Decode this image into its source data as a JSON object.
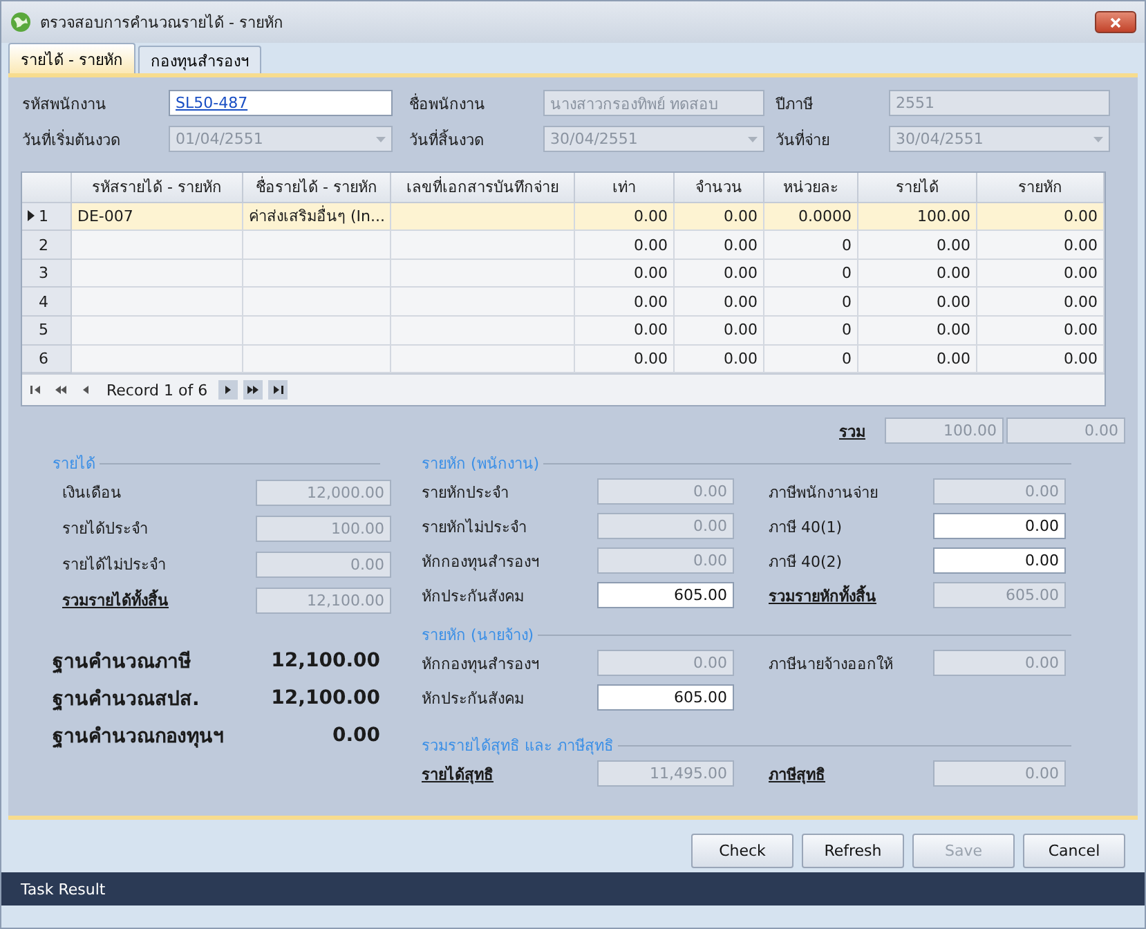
{
  "window": {
    "title": "ตรวจสอบการคำนวณรายได้ - รายหัก"
  },
  "tabs": [
    {
      "label": "รายได้ - รายหัก",
      "selected": true
    },
    {
      "label": "กองทุนสำรองฯ",
      "selected": false
    }
  ],
  "header_fields": [
    {
      "label": "รหัสพนักงาน",
      "value": "SL50-487",
      "kind": "link",
      "disabled": false
    },
    {
      "label": "ชื่อพนักงาน",
      "value": "นางสาวกรองทิพย์ ทดสอบ",
      "kind": "text",
      "disabled": true
    },
    {
      "label": "ปีภาษี",
      "value": "2551",
      "kind": "text",
      "disabled": true
    },
    {
      "label": "วันที่เริ่มต้นงวด",
      "value": "01/04/2551",
      "kind": "date",
      "disabled": true
    },
    {
      "label": "วันที่สิ้นงวด",
      "value": "30/04/2551",
      "kind": "date",
      "disabled": true
    },
    {
      "label": "วันที่จ่าย",
      "value": "30/04/2551",
      "kind": "date",
      "disabled": true
    }
  ],
  "grid": {
    "columns": [
      "รหัสรายได้ - รายหัก",
      "ชื่อรายได้ - รายหัก",
      "เลขที่เอกสารบันทึกจ่าย",
      "เท่า",
      "จำนวน",
      "หน่วยละ",
      "รายได้",
      "รายหัก"
    ],
    "rows": [
      {
        "number": "1",
        "selected": true,
        "cells": [
          "DE-007",
          "ค่าส่งเสริมอื่นๆ (In...",
          null,
          "0.00",
          "0.00",
          "0.0000",
          "100.00",
          "0.00"
        ]
      },
      {
        "number": "2",
        "selected": false,
        "cells": [
          null,
          null,
          null,
          "0.00",
          "0.00",
          "0",
          "0.00",
          "0.00"
        ]
      },
      {
        "number": "3",
        "selected": false,
        "cells": [
          null,
          null,
          null,
          "0.00",
          "0.00",
          "0",
          "0.00",
          "0.00"
        ]
      },
      {
        "number": "4",
        "selected": false,
        "cells": [
          null,
          null,
          null,
          "0.00",
          "0.00",
          "0",
          "0.00",
          "0.00"
        ]
      },
      {
        "number": "5",
        "selected": false,
        "cells": [
          null,
          null,
          null,
          "0.00",
          "0.00",
          "0",
          "0.00",
          "0.00"
        ]
      },
      {
        "number": "6",
        "selected": false,
        "cells": [
          null,
          null,
          null,
          "0.00",
          "0.00",
          "0",
          "0.00",
          "0.00"
        ]
      }
    ],
    "navigator": {
      "record_text": "Record 1 of 6"
    }
  },
  "totals": {
    "label": "รวม",
    "values": [
      "100.00",
      "0.00"
    ]
  },
  "income": {
    "title": "รายได้",
    "rows": [
      {
        "label": "เงินเดือน",
        "value": "12,000.00",
        "disabled": true,
        "emphasis": false
      },
      {
        "label": "รายได้ประจำ",
        "value": "100.00",
        "disabled": true,
        "emphasis": false
      },
      {
        "label": "รายได้ไม่ประจำ",
        "value": "0.00",
        "disabled": true,
        "emphasis": false
      },
      {
        "label": "รวมรายได้ทั้งสิ้น",
        "value": "12,100.00",
        "disabled": true,
        "emphasis": true
      }
    ]
  },
  "bases": [
    {
      "label": "ฐานคำนวณภาษี",
      "value": "12,100.00"
    },
    {
      "label": "ฐานคำนวณสปส.",
      "value": "12,100.00"
    },
    {
      "label": "ฐานคำนวณกองทุนฯ",
      "value": "0.00"
    }
  ],
  "sections": [
    {
      "title": "รายหัก (พนักงาน)",
      "rows": [
        {
          "left": {
            "label": "รายหักประจำ",
            "value": "0.00",
            "disabled": true,
            "emphasis": false
          },
          "right": {
            "label": "ภาษีพนักงานจ่าย",
            "value": "0.00",
            "disabled": true,
            "emphasis": false
          }
        },
        {
          "left": {
            "label": "รายหักไม่ประจำ",
            "value": "0.00",
            "disabled": true,
            "emphasis": false
          },
          "right": {
            "label": "ภาษี 40(1)",
            "value": "0.00",
            "disabled": false,
            "emphasis": false
          }
        },
        {
          "left": {
            "label": "หักกองทุนสำรองฯ",
            "value": "0.00",
            "disabled": true,
            "emphasis": false
          },
          "right": {
            "label": "ภาษี 40(2)",
            "value": "0.00",
            "disabled": false,
            "emphasis": false
          }
        },
        {
          "left": {
            "label": "หักประกันสังคม",
            "value": "605.00",
            "disabled": false,
            "emphasis": false
          },
          "right": {
            "label": "รวมรายหักทั้งสิ้น",
            "value": "605.00",
            "disabled": true,
            "emphasis": true
          }
        }
      ]
    },
    {
      "title": "รายหัก (นายจ้าง)",
      "rows": [
        {
          "left": {
            "label": "หักกองทุนสำรองฯ",
            "value": "0.00",
            "disabled": true,
            "emphasis": false
          },
          "right": {
            "label": "ภาษีนายจ้างออกให้",
            "value": "0.00",
            "disabled": true,
            "emphasis": false
          }
        },
        {
          "left": {
            "label": "หักประกันสังคม",
            "value": "605.00",
            "disabled": false,
            "emphasis": false
          }
        }
      ]
    },
    {
      "title": "รวมรายได้สุทธิ และ ภาษีสุทธิ",
      "rows": [
        {
          "left": {
            "label": "รายได้สุทธิ",
            "value": "11,495.00",
            "disabled": true,
            "emphasis": true
          },
          "right": {
            "label": "ภาษีสุทธิ",
            "value": "0.00",
            "disabled": true,
            "emphasis": true
          }
        }
      ]
    }
  ],
  "buttons": [
    {
      "label": "Check",
      "disabled": false
    },
    {
      "label": "Refresh",
      "disabled": false
    },
    {
      "label": "Save",
      "disabled": true
    },
    {
      "label": "Cancel",
      "disabled": false
    }
  ],
  "status_bar": {
    "text": "Task Result"
  }
}
